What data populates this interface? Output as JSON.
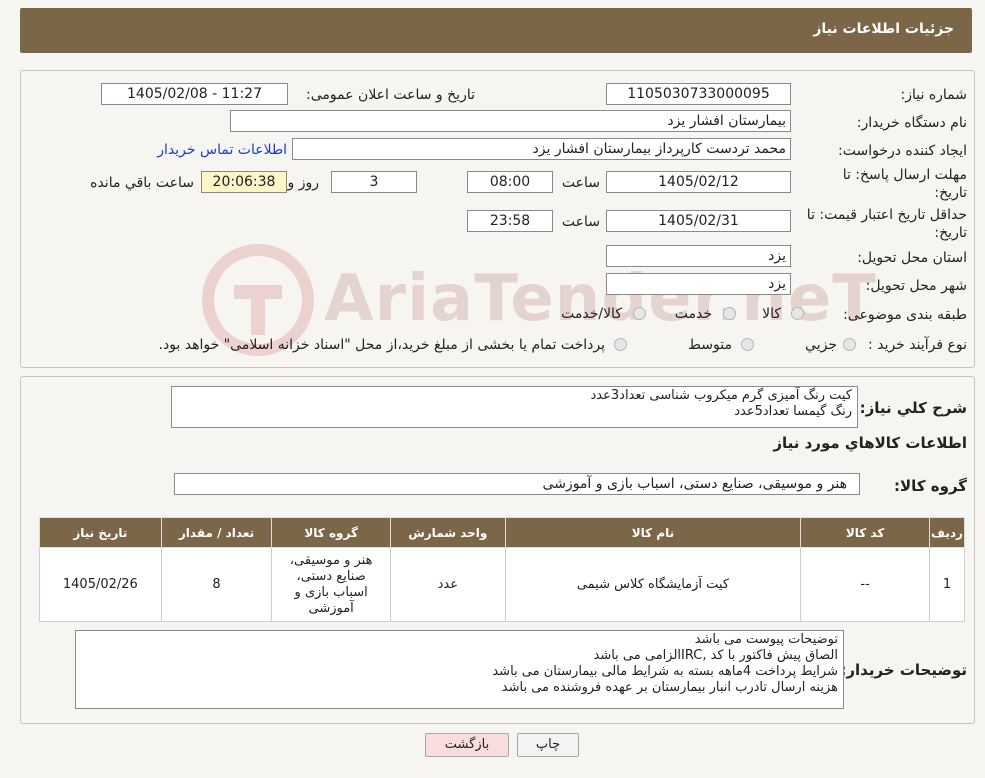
{
  "header": {
    "title": "جزئیات اطلاعات نیاز"
  },
  "form": {
    "need_number_label": "شماره نیاز:",
    "need_number": "1105030733000095",
    "announce_label": "تاریخ و ساعت اعلان عمومی:",
    "announce_value": "1405/02/08 - 11:27",
    "buyer_org_label": "نام دستگاه خریدار:",
    "buyer_org": "بیمارستان افشار یزد",
    "creator_label": "ایجاد کننده درخواست:",
    "creator": "محمد تردست کارپرداز بیمارستان افشار یزد",
    "contact_link": "اطلاعات تماس خریدار",
    "deadline_label_1": "مهلت ارسال پاسخ: تا",
    "deadline_label_2": "تاریخ:",
    "deadline_date": "1405/02/12",
    "time_label": "ساعت",
    "deadline_time": "08:00",
    "days": "3",
    "days_label": "روز و",
    "remaining_time": "20:06:38",
    "remaining_label": "ساعت باقي مانده",
    "validity_label_1": "حداقل تاریخ اعتبار قیمت: تا",
    "validity_label_2": "تاریخ:",
    "validity_date": "1405/02/31",
    "validity_time": "23:58",
    "province_label": "استان محل تحویل:",
    "province": "یزد",
    "city_label": "شهر محل تحویل:",
    "city": "یزد",
    "category_label": "طبقه بندی موضوعی:",
    "category_options": [
      "کالا",
      "خدمت",
      "کالا/خدمت"
    ],
    "process_label": "نوع فرآیند خرید :",
    "process_options": [
      "جزیي",
      "متوسط"
    ],
    "process_note": "پرداخت تمام یا بخشی از مبلغ خرید،از محل \"اسناد خزانه اسلامی\" خواهد بود."
  },
  "description": {
    "label": "شرح کلي نیاز:",
    "text": "کیت رنگ آمیزی گرم میکروب شناسی تعداد3عدد\nرنگ گیمسا تعداد5عدد"
  },
  "goods": {
    "section_title": "اطلاعات کالاهاي مورد نیاز",
    "group_label": "گروه کالا:",
    "group_value": "هنر و موسیقی، صنایع دستی، اسباب بازی و آموزشی",
    "columns": [
      "ردیف",
      "کد کالا",
      "نام کالا",
      "واحد شمارش",
      "گروه کالا",
      "تعداد / مقدار",
      "تاریخ نیاز"
    ],
    "rows": [
      [
        "1",
        "--",
        "کیت آزمایشگاه کلاس شیمی",
        "عدد",
        "هنر و موسیقی، صنایع دستی، اسباب بازی و آموزشی",
        "8",
        "1405/02/26"
      ]
    ]
  },
  "buyer_notes": {
    "label": "توضیحات خریدار:",
    "text": "توضیحات پیوست می باشد\nالصاق پیش فاکتور با کد  ,IRCالزامی می باشد\nشرایط پرداخت  4ماهه بسته به شرایط مالی بیمارستان می باشد\nهزینه ارسال تادرب انبار بیمارستان بر عهده فروشنده می باشد"
  },
  "buttons": {
    "print": "چاپ",
    "back": "بازگشت"
  },
  "watermark": "AriaTender.neT",
  "colors": {
    "header_bg": "#7b6648",
    "link": "#1a3fc2",
    "highlight": "#fdf4c8",
    "back_button": "#f9dcdc"
  }
}
